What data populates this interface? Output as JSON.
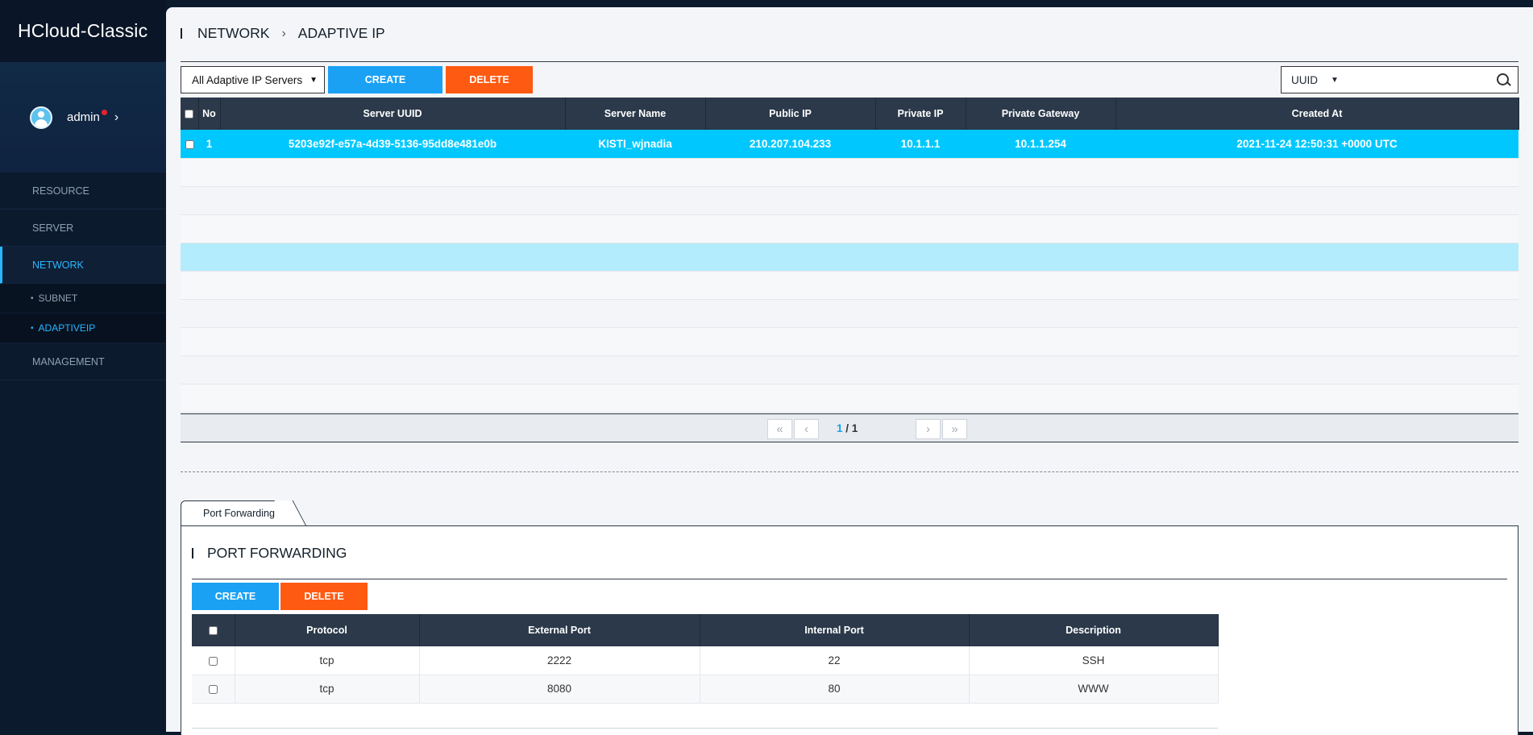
{
  "sidebar": {
    "brand": "HCloud-Classic",
    "user": "admin",
    "nav": [
      "RESOURCE",
      "SERVER",
      "NETWORK"
    ],
    "sub": [
      "SUBNET",
      "ADAPTIVEIP"
    ],
    "nav_after": [
      "MANAGEMENT"
    ]
  },
  "breadcrumb": {
    "section": "NETWORK",
    "page": "ADAPTIVE IP"
  },
  "toolbar": {
    "filter": "All Adaptive IP Servers",
    "create": "CREATE",
    "delete": "DELETE"
  },
  "search": {
    "field": "UUID",
    "value": ""
  },
  "table": {
    "headers": [
      "No",
      "Server UUID",
      "Server Name",
      "Public IP",
      "Private IP",
      "Private Gateway",
      "Created At"
    ],
    "rows": [
      [
        "1",
        "5203e92f-e57a-4d39-5136-95dd8e481e0b",
        "KISTI_wjnadia",
        "210.207.104.233",
        "10.1.1.1",
        "10.1.1.254",
        "2021-11-24 12:50:31 +0000 UTC"
      ]
    ]
  },
  "pagination": {
    "current": "1",
    "total": "1"
  },
  "tab": {
    "label": "Port Forwarding"
  },
  "port_forwarding": {
    "title": "PORT FORWARDING",
    "create": "CREATE",
    "delete": "DELETE",
    "headers": [
      "Protocol",
      "External Port",
      "Internal Port",
      "Description"
    ],
    "rows": [
      [
        "tcp",
        "2222",
        "22",
        "SSH"
      ],
      [
        "tcp",
        "8080",
        "80",
        "WWW"
      ]
    ]
  },
  "colors": {
    "accent": "#1aa1f4",
    "danger": "#ff5a12",
    "selected_row": "#00c8ff",
    "header": "#2b394a",
    "sidebar": "#0c1a2e"
  }
}
